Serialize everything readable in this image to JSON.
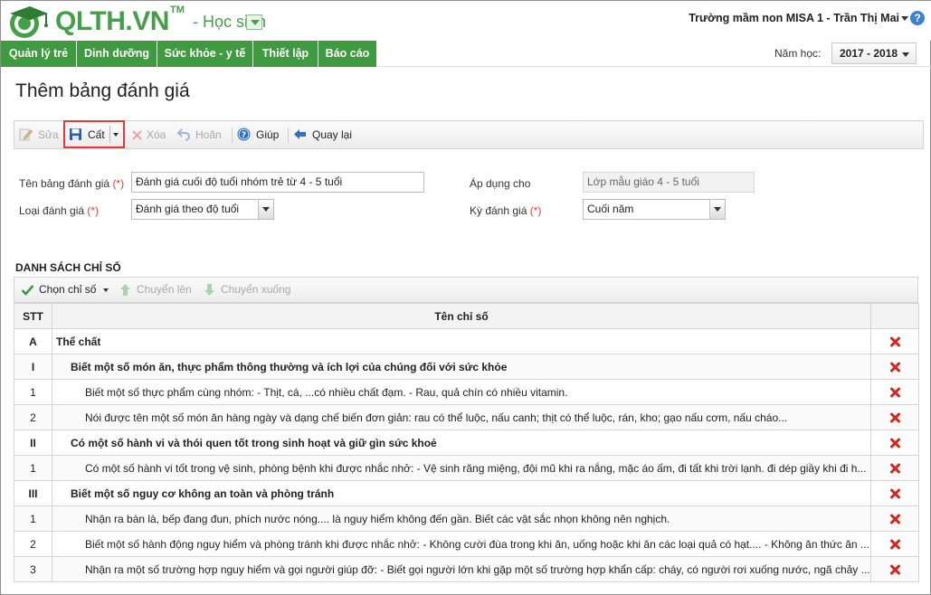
{
  "header": {
    "brand": "QLTH.VN",
    "brand_tm": "TM",
    "role": "- Học sinh",
    "school_user": "Trường mầm non MISA 1 - Trần Thị Mai",
    "help": "?"
  },
  "nav": {
    "items": [
      "Quản lý trẻ",
      "Dinh dưỡng",
      "Sức khỏe - y tế",
      "Thiết lập",
      "Báo cáo"
    ],
    "year_label": "Năm học:",
    "year_value": "2017 - 2018"
  },
  "page": {
    "title": "Thêm bảng đánh giá"
  },
  "toolbar": {
    "edit": "Sửa",
    "save": "Cất",
    "delete": "Xóa",
    "undo": "Hoãn",
    "help": "Giúp",
    "back": "Quay lại"
  },
  "form": {
    "name_label": "Tên bảng đánh giá",
    "name_value": "Đánh giá cuối độ tuổi nhóm trẻ từ 4 - 5 tuổi",
    "type_label": "Loại đánh giá",
    "type_value": "Đánh giá theo độ tuổi",
    "apply_label": "Áp dụng cho",
    "apply_value": "Lớp mẫu giáo 4 - 5 tuổi",
    "period_label": "Kỳ đánh giá",
    "period_value": "Cuối năm",
    "required_mark": "(*)"
  },
  "list": {
    "section_title": "DANH SÁCH CHỈ SỐ",
    "choose": "Chọn chỉ số",
    "move_up": "Chuyển lên",
    "move_down": "Chuyển xuống",
    "col_stt": "STT",
    "col_name": "Tên chỉ số",
    "rows": [
      {
        "stt": "A",
        "name": "Thể chất",
        "level": 0
      },
      {
        "stt": "I",
        "name": "Biết một số món ăn, thực phẩm thông thường và ích lợi của chúng đối với sức khỏe",
        "level": 1
      },
      {
        "stt": "1",
        "name": "Biết một số thực phẩm cùng nhóm: - Thịt, cá, ...có nhiều chất đạm. - Rau, quả chín có nhiều vitamin.",
        "level": 2
      },
      {
        "stt": "2",
        "name": "Nói được tên một số món ăn hàng ngày và dạng chế biến đơn giản: rau có thể luộc, nấu canh; thịt có thể luộc, rán, kho; gạo nấu cơm, nấu cháo...",
        "level": 2
      },
      {
        "stt": "II",
        "name": "Có một số hành vi và thói quen tốt trong sinh hoạt và giữ gìn sức khoẻ",
        "level": 1
      },
      {
        "stt": "1",
        "name": "Có một số hành vi tốt trong vệ sinh, phòng bệnh khi được nhắc nhở: - Vệ sinh răng miệng, đội mũ khi ra nắng, mặc áo ấm, đi tất khi trời lạnh. đi dép giầy khi đi h...",
        "level": 2
      },
      {
        "stt": "III",
        "name": "Biết một số nguy cơ không an toàn và phòng tránh",
        "level": 1
      },
      {
        "stt": "1",
        "name": "Nhận ra bàn là, bếp đang đun, phích nước nóng.... là nguy hiểm không đến gần. Biết các vật sắc nhọn không nên nghịch.",
        "level": 2
      },
      {
        "stt": "2",
        "name": "Biết một số hành động nguy hiểm và phòng tránh khi được nhắc nhở: - Không cười đùa trong khi ăn, uống hoặc khi ăn các loại quả có hạt.... - Không ăn thức ăn ...",
        "level": 2
      },
      {
        "stt": "3",
        "name": "Nhận ra một số trường hợp nguy hiểm và gọi người giúp đỡ: - Biết gọi người lớn khi gặp một số trường hợp khẩn cấp: cháy, có người rơi xuống nước, ngã chảy ...",
        "level": 2
      }
    ]
  },
  "colors": {
    "brand_green": "#43a047",
    "nav_green": "#3f9b3f",
    "delete_red": "#d7261e",
    "highlight": "#e03a3a"
  }
}
